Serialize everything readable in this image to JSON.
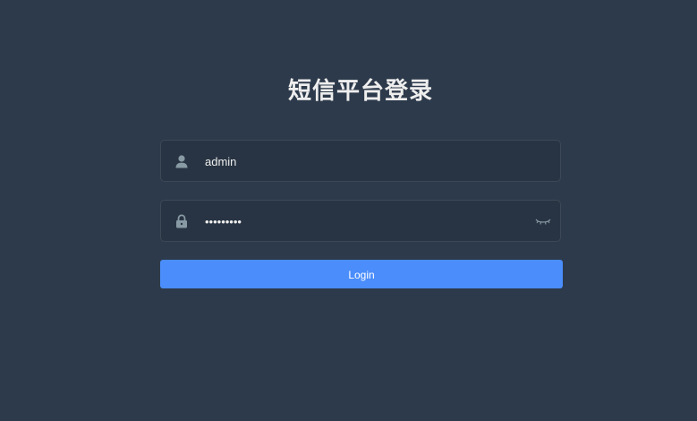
{
  "title": "短信平台登录",
  "username": {
    "value": "admin",
    "icon": "user-icon"
  },
  "password": {
    "masked_value": "•••••••••",
    "icon": "lock-icon",
    "toggle_icon": "eye-closed-icon"
  },
  "login_button": {
    "label": "Login",
    "color": "#4a8dfb"
  },
  "colors": {
    "background": "#2d3a4b",
    "input_background": "#283443",
    "text": "#eeeeee",
    "icon": "#889aa4"
  }
}
